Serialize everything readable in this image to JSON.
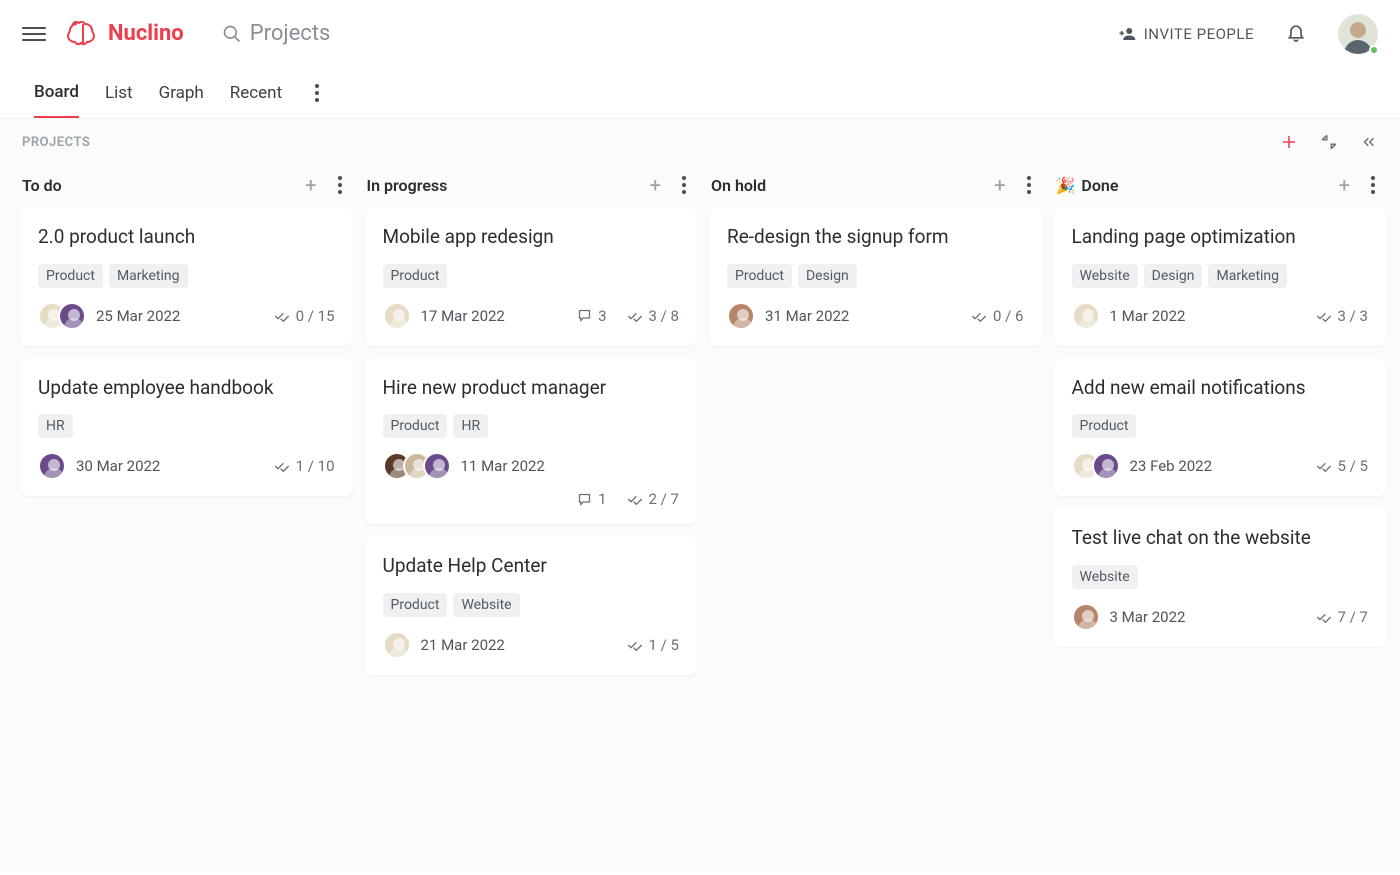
{
  "app": {
    "name": "Nuclino"
  },
  "header": {
    "search_placeholder": "Projects",
    "invite_label": "INVITE PEOPLE"
  },
  "tabs": {
    "items": [
      "Board",
      "List",
      "Graph",
      "Recent"
    ],
    "active": 0
  },
  "subheader": {
    "title": "PROJECTS"
  },
  "columns": [
    {
      "title": "To do",
      "emoji": "",
      "cards": [
        {
          "title": "2.0 product launch",
          "tags": [
            "Product",
            "Marketing"
          ],
          "date": "25 Mar 2022",
          "avatars": [
            "c0",
            "c1"
          ],
          "comments": null,
          "checklist": "0 / 15"
        },
        {
          "title": "Update employee handbook",
          "tags": [
            "HR"
          ],
          "date": "30 Mar 2022",
          "avatars": [
            "c1"
          ],
          "comments": null,
          "checklist": "1 / 10"
        }
      ]
    },
    {
      "title": "In progress",
      "emoji": "",
      "cards": [
        {
          "title": "Mobile app redesign",
          "tags": [
            "Product"
          ],
          "date": "17 Mar 2022",
          "avatars": [
            "c0"
          ],
          "comments": "3",
          "checklist": "3 / 8"
        },
        {
          "title": "Hire new product manager",
          "tags": [
            "Product",
            "HR"
          ],
          "date": "11 Mar 2022",
          "avatars": [
            "c3",
            "c4",
            "c1"
          ],
          "comments": "1",
          "checklist": "2 / 7",
          "two_row_footer": true
        },
        {
          "title": "Update Help Center",
          "tags": [
            "Product",
            "Website"
          ],
          "date": "21 Mar 2022",
          "avatars": [
            "c0"
          ],
          "comments": null,
          "checklist": "1 / 5"
        }
      ]
    },
    {
      "title": "On hold",
      "emoji": "",
      "cards": [
        {
          "title": "Re-design the signup form",
          "tags": [
            "Product",
            "Design"
          ],
          "date": "31 Mar 2022",
          "avatars": [
            "c2"
          ],
          "comments": null,
          "checklist": "0 / 6"
        }
      ]
    },
    {
      "title": "Done",
      "emoji": "🎉",
      "cards": [
        {
          "title": "Landing page optimization",
          "tags": [
            "Website",
            "Design",
            "Marketing"
          ],
          "date": "1 Mar 2022",
          "avatars": [
            "c0"
          ],
          "comments": null,
          "checklist": "3 / 3"
        },
        {
          "title": "Add new email notifications",
          "tags": [
            "Product"
          ],
          "date": "23 Feb 2022",
          "avatars": [
            "c0",
            "c1"
          ],
          "comments": null,
          "checklist": "5 / 5"
        },
        {
          "title": "Test live chat on the website",
          "tags": [
            "Website"
          ],
          "date": "3 Mar 2022",
          "avatars": [
            "c2"
          ],
          "comments": null,
          "checklist": "7 / 7"
        }
      ]
    }
  ]
}
